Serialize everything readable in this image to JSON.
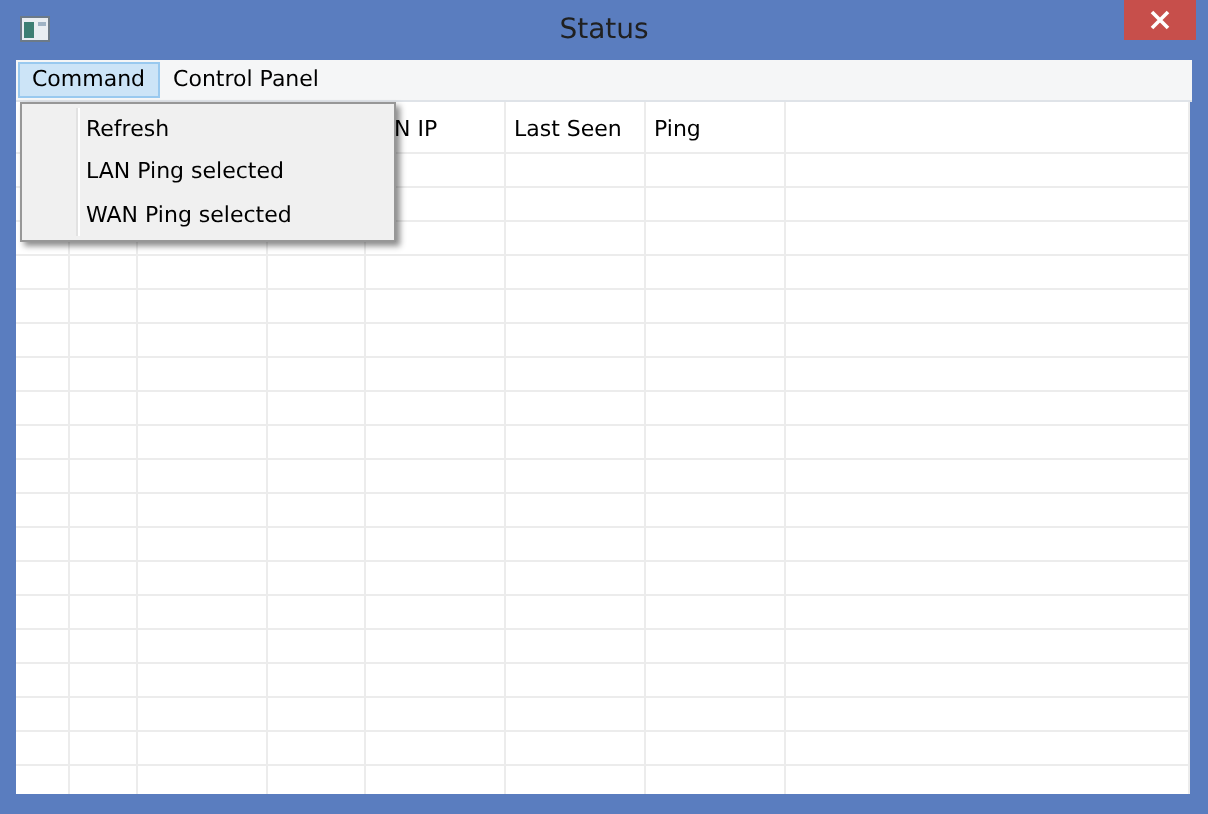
{
  "window": {
    "title": "Status"
  },
  "menubar": [
    {
      "label": "Command",
      "selected": true
    },
    {
      "label": "Control Panel",
      "selected": false
    }
  ],
  "dropdown": {
    "items": [
      "Refresh",
      "LAN Ping selected",
      "WAN Ping selected"
    ]
  },
  "table": {
    "columns": [
      "N IP",
      "Last Seen",
      "Ping"
    ]
  }
}
